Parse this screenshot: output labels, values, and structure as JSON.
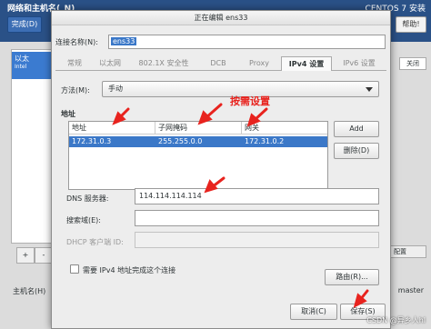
{
  "background": {
    "title": "网络和主机名(_N)",
    "right_title": "CENTOS 7 安装",
    "done_button": "完成(D)",
    "help_button": "帮助!",
    "list_item_name": "以太",
    "list_item_sub": "Intel",
    "add_button": "+",
    "remove_button": "-",
    "hostname_label": "主机名(H)",
    "hostname_value": "master",
    "toggle_label": "关闭",
    "config_button": "配置"
  },
  "dialog": {
    "title": "正在编辑 ens33",
    "connection_name_label": "连接名称(N):",
    "connection_name_value": "ens33",
    "tabs": [
      {
        "label": "常规",
        "active": false
      },
      {
        "label": "以太网",
        "active": false
      },
      {
        "label": "802.1X 安全性",
        "active": false
      },
      {
        "label": "DCB",
        "active": false
      },
      {
        "label": "Proxy",
        "active": false
      },
      {
        "label": "IPv4 设置",
        "active": true
      },
      {
        "label": "IPv6 设置",
        "active": false
      }
    ],
    "method_label": "方法(M):",
    "method_value": "手动",
    "address_section_label": "地址",
    "address_columns": [
      "地址",
      "子网掩码",
      "网关"
    ],
    "address_rows": [
      {
        "address": "172.31.0.3",
        "netmask": "255.255.0.0",
        "gateway": "172.31.0.2"
      }
    ],
    "add_button": "Add",
    "delete_button": "删除(D)",
    "dns_label": "DNS 服务器:",
    "dns_value": "114.114.114.114",
    "search_domain_label": "搜索域(E):",
    "search_domain_value": "",
    "dhcp_client_id_label": "DHCP 客户端 ID:",
    "dhcp_client_id_value": "",
    "require_ipv4_label": "需要 IPv4 地址完成这个连接",
    "require_ipv4_checked": false,
    "routes_button": "路由(R)...",
    "cancel_button": "取消(C)",
    "save_button": "保存(S)"
  },
  "annotation": {
    "text": "按需设置",
    "color": "#e8231e"
  },
  "watermark": "CSDN @异乡人hl",
  "colors": {
    "selection": "#3b78c8",
    "header": "#2a5187"
  }
}
